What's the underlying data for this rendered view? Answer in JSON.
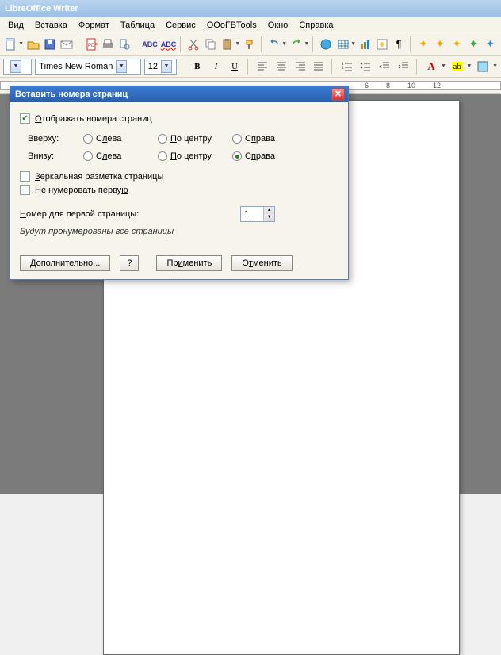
{
  "app_title": "LibreOffice Writer",
  "menubar": {
    "view": "Вид",
    "insert": "Вставка",
    "format": "Формат",
    "table": "Таблица",
    "tools": "Сервис",
    "ooofbtools": "OOoFBTools",
    "window": "Окно",
    "help": "Справка"
  },
  "toolbar": {
    "icons": [
      "new",
      "open",
      "save",
      "email",
      "pdf",
      "print",
      "preview",
      "spellcheck",
      "format2",
      "cut",
      "copy",
      "paste",
      "paintbrush",
      "undo",
      "redo",
      "link",
      "table",
      "chart",
      "navigator",
      "styles",
      "grid",
      "nonprint",
      "find",
      "star1",
      "star2",
      "star3",
      "star4"
    ]
  },
  "fontrow": {
    "style_combo": "",
    "font_name": "Times New Roman",
    "font_size": "12",
    "bold": "B",
    "italic": "I",
    "underline": "U"
  },
  "ruler": {
    "marks": [
      "6",
      "8",
      "10",
      "12"
    ]
  },
  "dialog": {
    "title": "Вставить номера страниц",
    "show_numbers": "Отображать номера страниц",
    "show_numbers_checked": true,
    "top_label": "Вверху:",
    "bottom_label": "Внизу:",
    "left": "Слева",
    "center": "По центру",
    "right": "Справа",
    "selected_row": "bottom",
    "selected_col": "right",
    "mirror": "Зеркальная разметка страницы",
    "mirror_checked": false,
    "skip_first": "Не нумеровать первую",
    "skip_first_checked": false,
    "first_page_label": "Номер для первой страницы:",
    "first_page_value": "1",
    "hint": "Будут пронумерованы все страницы",
    "btn_more": "Дополнительно...",
    "btn_help": "?",
    "btn_apply": "Применить",
    "btn_cancel": "Отменить"
  }
}
